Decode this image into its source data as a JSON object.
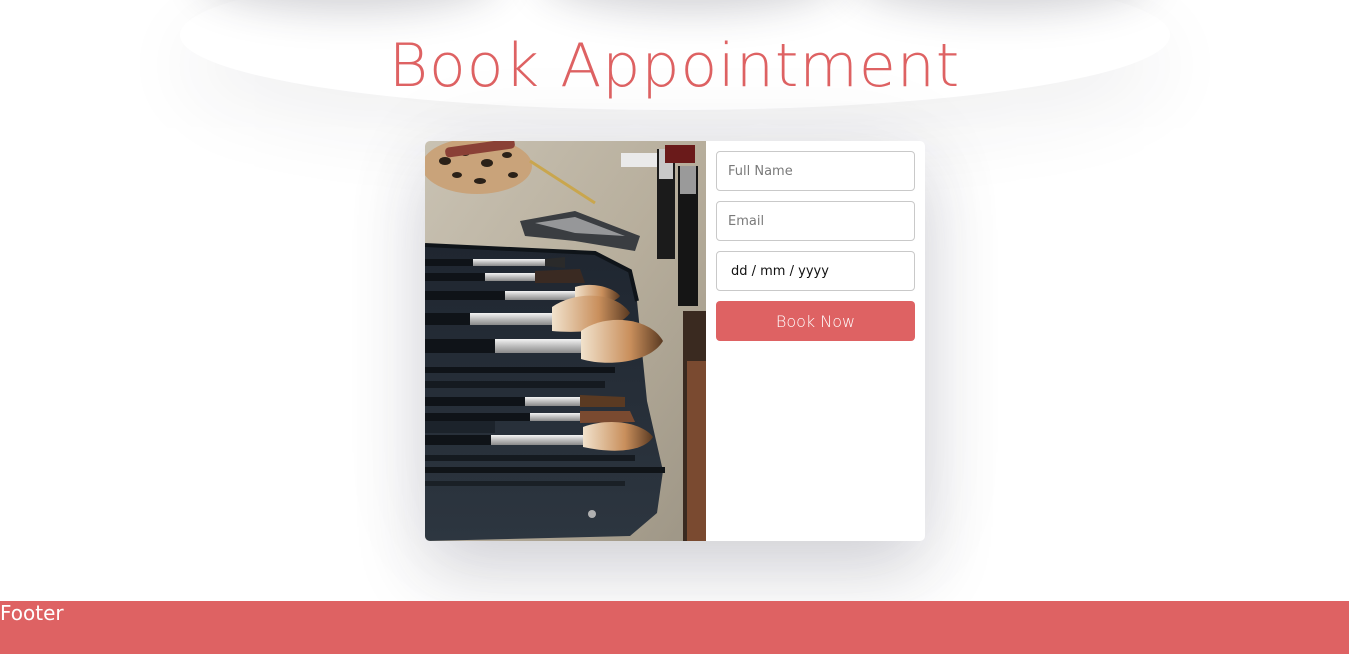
{
  "page": {
    "title": "Book Appointment",
    "accent_color": "#de6263"
  },
  "card": {
    "image": "makeup-brushes-photo"
  },
  "form": {
    "full_name_placeholder": "Full Name",
    "email_placeholder": "Email",
    "date_placeholder": "dd / mm / yyyy",
    "submit_label": "Book Now"
  },
  "footer": {
    "label": "Footer"
  }
}
